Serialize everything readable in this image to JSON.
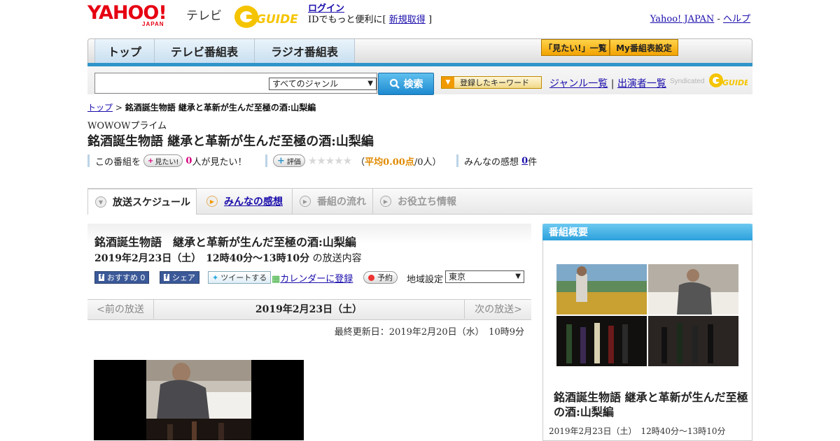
{
  "header": {
    "logo_text": "YAHOO!",
    "logo_sub": "JAPAN",
    "tv_label": "テレビ",
    "gguide_label": "GUIDE",
    "login_label": "ログイン",
    "login_prompt": "IDでもっと便利に[",
    "signup_label": "新規取得",
    "login_prompt_end": "]",
    "yahoo_japan_link": "Yahoo! JAPAN",
    "link_sep": " - ",
    "help_link": "ヘルプ"
  },
  "nav": {
    "tabs": [
      {
        "label": "トップ"
      },
      {
        "label": "テレビ番組表"
      },
      {
        "label": "ラジオ番組表"
      }
    ],
    "mitai_list": "「見たい!」一覧",
    "my_schedule": "My番組表設定"
  },
  "search": {
    "input_value": "",
    "genre_selected": "すべてのジャンル",
    "search_button": "検索",
    "registered_keyword": "登録したキーワード",
    "genre_list": "ジャンル一覧",
    "sep": "|",
    "cast_list": "出演者一覧",
    "syndicated": "Syndicated"
  },
  "breadcrumb": {
    "top": "トップ",
    "sep": " > ",
    "current": "銘酒誕生物語 継承と革新が生んだ至極の酒:山梨編"
  },
  "program": {
    "channel": "WOWOWプライム",
    "title": "銘酒誕生物語 継承と革新が生んだ至極の酒:山梨編",
    "this_program": "この番組を",
    "mitai_button": "見たい!",
    "mitai_count": "0",
    "mitai_suffix": "人が見たい！",
    "rating_button": "評価",
    "stars": "★★★★★",
    "avg_open": "（",
    "avg_label": "平均0.00点",
    "avg_count": "/0人）",
    "impressions_label": "みんなの感想",
    "impressions_count": "0",
    "impressions_suffix": "件"
  },
  "subtabs": [
    {
      "label": "放送スケジュール",
      "active": true
    },
    {
      "label": "みんなの感想",
      "active": false
    },
    {
      "label": "番組の流れ",
      "active": false
    },
    {
      "label": "お役立ち情報",
      "active": false
    }
  ],
  "broadcast": {
    "title": "銘酒誕生物語　継承と革新が生んだ至極の酒:山梨編",
    "datetime": "2019年2月23日（土）　12時40分～13時10分",
    "datetime_suffix": " の放送内容",
    "recommend": "おすすめ",
    "recommend_count": "0",
    "share": "シェア",
    "tweet": "ツイートする",
    "calendar": "カレンダーに登録",
    "reserve": "予約",
    "region_label": "地域設定",
    "region_selected": "東京",
    "prev": "<前の放送",
    "current_date": "2019年2月23日（土）",
    "next": "次の放送>",
    "last_updated": "最終更新日：2019年2月20日（水）　10時9分"
  },
  "sidebar": {
    "header": "番組概要",
    "title": "銘酒誕生物語 継承と革新が生んだ至極の酒:山梨編",
    "time": "2019年2月23日（土）　12時40分～13時10分"
  },
  "colors": {
    "accent_blue": "#2f95c9",
    "yahoo_red": "#e60012",
    "gold": "#f2a200",
    "link": "#1a0dab"
  }
}
